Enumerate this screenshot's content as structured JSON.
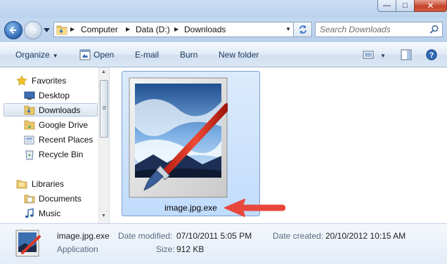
{
  "window": {
    "minimize_glyph": "—",
    "maximize_glyph": "□",
    "close_glyph": "✕"
  },
  "address_bar": {
    "crumbs": [
      "Computer",
      "Data (D:)",
      "Downloads"
    ]
  },
  "search": {
    "placeholder": "Search Downloads"
  },
  "toolbar": {
    "organize": "Organize",
    "open": "Open",
    "email": "E-mail",
    "burn": "Burn",
    "new_folder": "New folder"
  },
  "nav": {
    "favorites": "Favorites",
    "desktop": "Desktop",
    "downloads": "Downloads",
    "google_drive": "Google Drive",
    "recent_places": "Recent Places",
    "recycle_bin": "Recycle Bin",
    "libraries": "Libraries",
    "documents": "Documents",
    "music": "Music"
  },
  "file": {
    "name": "image.jpg.exe"
  },
  "details": {
    "name": "image.jpg.exe",
    "type": "Application",
    "modified_label": "Date modified:",
    "modified_value": "07/10/2011 5:05 PM",
    "created_label": "Date created:",
    "created_value": "20/10/2012 10:15 AM",
    "size_label": "Size:",
    "size_value": "912 KB"
  },
  "colors": {
    "accent_arrow": "#e8473b",
    "selection": "#c1dcfc"
  }
}
